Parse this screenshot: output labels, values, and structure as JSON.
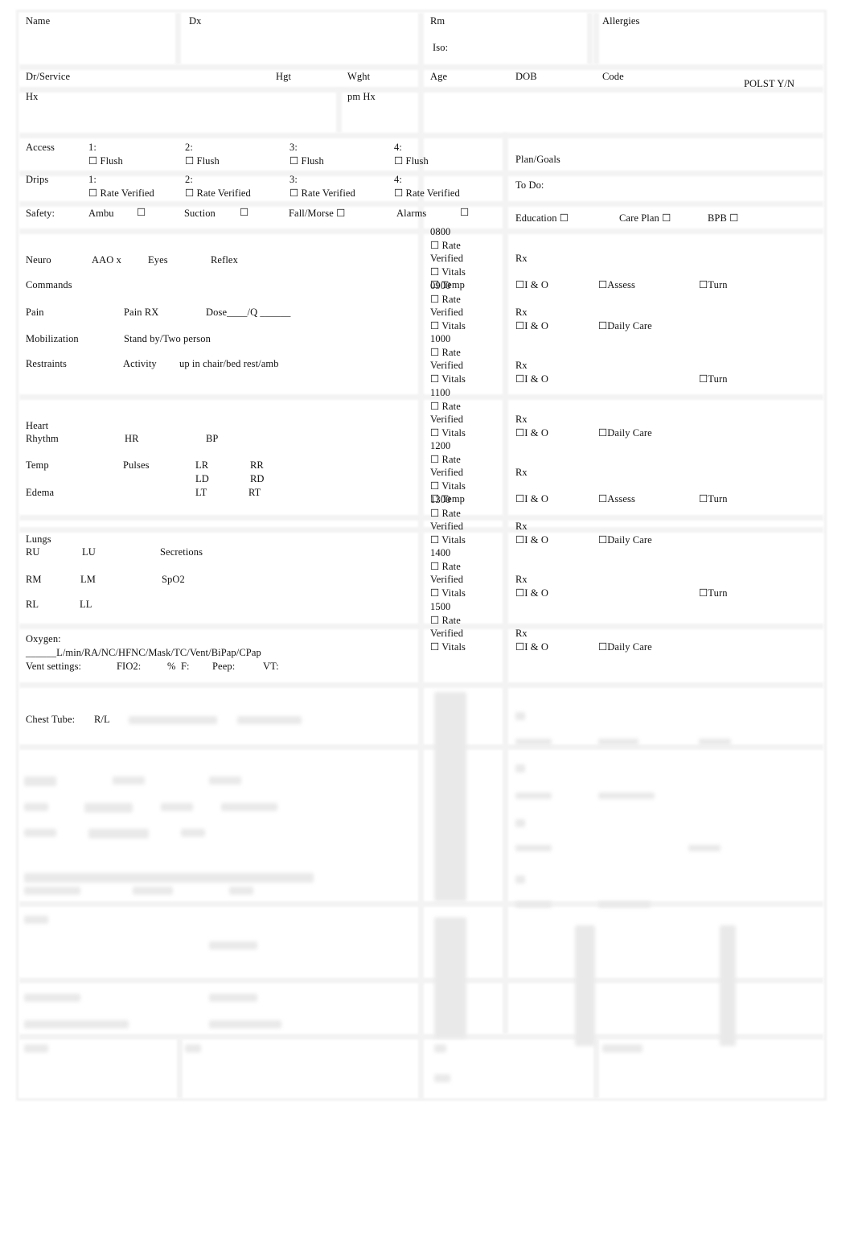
{
  "header": {
    "name": "Name",
    "dx": "Dx",
    "rm": "Rm",
    "allergies": "Allergies",
    "iso": "Iso:",
    "dr_service": "Dr/Service",
    "hgt": "Hgt",
    "wght": "Wght",
    "age": "Age",
    "dob": "DOB",
    "code": "Code",
    "polst": "POLST  Y/N",
    "hx": "Hx",
    "pm_hx": "pm Hx"
  },
  "access": {
    "label": "Access",
    "slots": [
      "1:",
      "2:",
      "3:",
      "4:"
    ],
    "flush": "☐ Flush"
  },
  "drips": {
    "label": "Drips",
    "slots": [
      "1:",
      "2:",
      "3:",
      "4:"
    ],
    "rate_verified": "☐ Rate Verified"
  },
  "safety": {
    "label": "Safety:",
    "items": [
      "Ambu",
      "Suction",
      "Fall/Morse  ☐",
      "Alarms"
    ],
    "checkbox": "☐"
  },
  "plan": {
    "plan_goals": "Plan/Goals",
    "to_do": "To Do:",
    "education": "Education ☐",
    "care_plan": "Care Plan ☐",
    "bpb": "BPB ☐"
  },
  "neuro": {
    "neuro": "Neuro",
    "aao": "AAO x",
    "eyes": "Eyes",
    "reflex": "Reflex",
    "commands": "Commands",
    "pain": "Pain",
    "pain_rx": "Pain RX",
    "dose": "Dose____/Q ______",
    "mobilization": "Mobilization",
    "stand_by": "Stand by/Two person",
    "restraints": "Restraints",
    "activity": "Activity",
    "activity_options": "up in chair/bed rest/amb"
  },
  "heart": {
    "heart": "Heart",
    "rhythm": "Rhythm",
    "hr": "HR",
    "bp": "BP",
    "temp": "Temp",
    "pulses": "Pulses",
    "lr": "LR",
    "rr": "RR",
    "ld": "LD",
    "rd": "RD",
    "edema": "Edema",
    "lt": "LT",
    "rt": "RT"
  },
  "lungs": {
    "lungs": "Lungs",
    "ru": "RU",
    "lu": "LU",
    "secretions": "Secretions",
    "rm": "RM",
    "lm": "LM",
    "spo2": "SpO2",
    "rl": "RL",
    "ll": "LL",
    "oxygen": "Oxygen:",
    "oxygen_options": "______L/min/RA/NC/HFNC/Mask/TC/Vent/BiPap/CPap",
    "vent_settings": "Vent settings:",
    "fio2": "FIO2:",
    "pct": "%",
    "f": "F:",
    "peep": "Peep:",
    "vt": "VT:"
  },
  "chest_tube": {
    "label": "Chest Tube:",
    "side": "R/L"
  },
  "timeline": {
    "rate": "☐ Rate",
    "verified": "Verified",
    "vitals": "☐ Vitals",
    "temp": "☐ Temp",
    "rx": "Rx",
    "io": "☐I & O",
    "assess": "☐Assess",
    "turn": "☐Turn",
    "daily_care": "☐Daily Care",
    "hours": [
      {
        "time": "0800",
        "extras": [
          "assess",
          "turn"
        ],
        "temp": true
      },
      {
        "time": "0900",
        "extras": [
          "daily_care"
        ]
      },
      {
        "time": "1000",
        "extras": [
          "turn"
        ]
      },
      {
        "time": "1100",
        "extras": [
          "daily_care"
        ]
      },
      {
        "time": "1200",
        "extras": [
          "assess",
          "turn"
        ],
        "temp": true
      },
      {
        "time": "1300",
        "extras": [
          "daily_care"
        ]
      },
      {
        "time": "1400",
        "extras": [
          "turn"
        ]
      },
      {
        "time": "1500",
        "extras": [
          "daily_care"
        ]
      }
    ]
  }
}
